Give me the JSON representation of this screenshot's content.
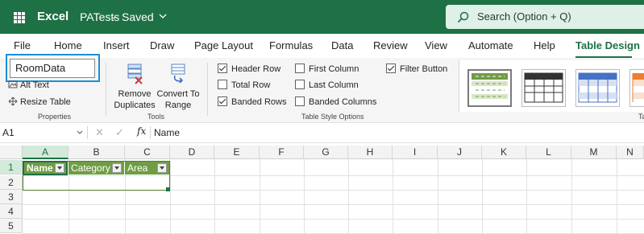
{
  "titlebar": {
    "app_name": "Excel",
    "doc_title": "PATests",
    "separator": "-",
    "doc_status": "Saved",
    "search_placeholder": "Search (Option + Q)"
  },
  "tabs": [
    {
      "label": "File"
    },
    {
      "label": "Home"
    },
    {
      "label": "Insert"
    },
    {
      "label": "Draw"
    },
    {
      "label": "Page Layout"
    },
    {
      "label": "Formulas"
    },
    {
      "label": "Data"
    },
    {
      "label": "Review"
    },
    {
      "label": "View"
    },
    {
      "label": "Automate"
    },
    {
      "label": "Help"
    },
    {
      "label": "Table Design",
      "active": true
    }
  ],
  "ribbon": {
    "properties": {
      "table_name": "RoomData",
      "alt_text": "Alt Text",
      "resize_table": "Resize Table",
      "label": "Properties"
    },
    "tools": {
      "remove_duplicates_line1": "Remove",
      "remove_duplicates_line2": "Duplicates",
      "convert_line1": "Convert To",
      "convert_line2": "Range",
      "label": "Tools"
    },
    "style_options": {
      "header_row": "Header Row",
      "total_row": "Total Row",
      "banded_rows": "Banded Rows",
      "first_column": "First Column",
      "last_column": "Last Column",
      "banded_columns": "Banded Columns",
      "filter_button": "Filter Button",
      "label": "Table Style Options"
    },
    "styles_label": "Ta"
  },
  "formula_bar": {
    "cell_ref": "A1",
    "cancel": "✕",
    "confirm": "✓",
    "fx": "fx",
    "content": "Name"
  },
  "grid": {
    "columns": [
      "A",
      "B",
      "C",
      "D",
      "E",
      "F",
      "G",
      "H",
      "I",
      "J",
      "K",
      "L",
      "M",
      "N"
    ],
    "rows": [
      "1",
      "2",
      "3",
      "4",
      "5"
    ],
    "table_headers": [
      "Name",
      "Category",
      "Area"
    ]
  },
  "colors": {
    "brand": "#1e7145",
    "table_header": "#6f9d44",
    "focus": "#1a8fd6"
  }
}
